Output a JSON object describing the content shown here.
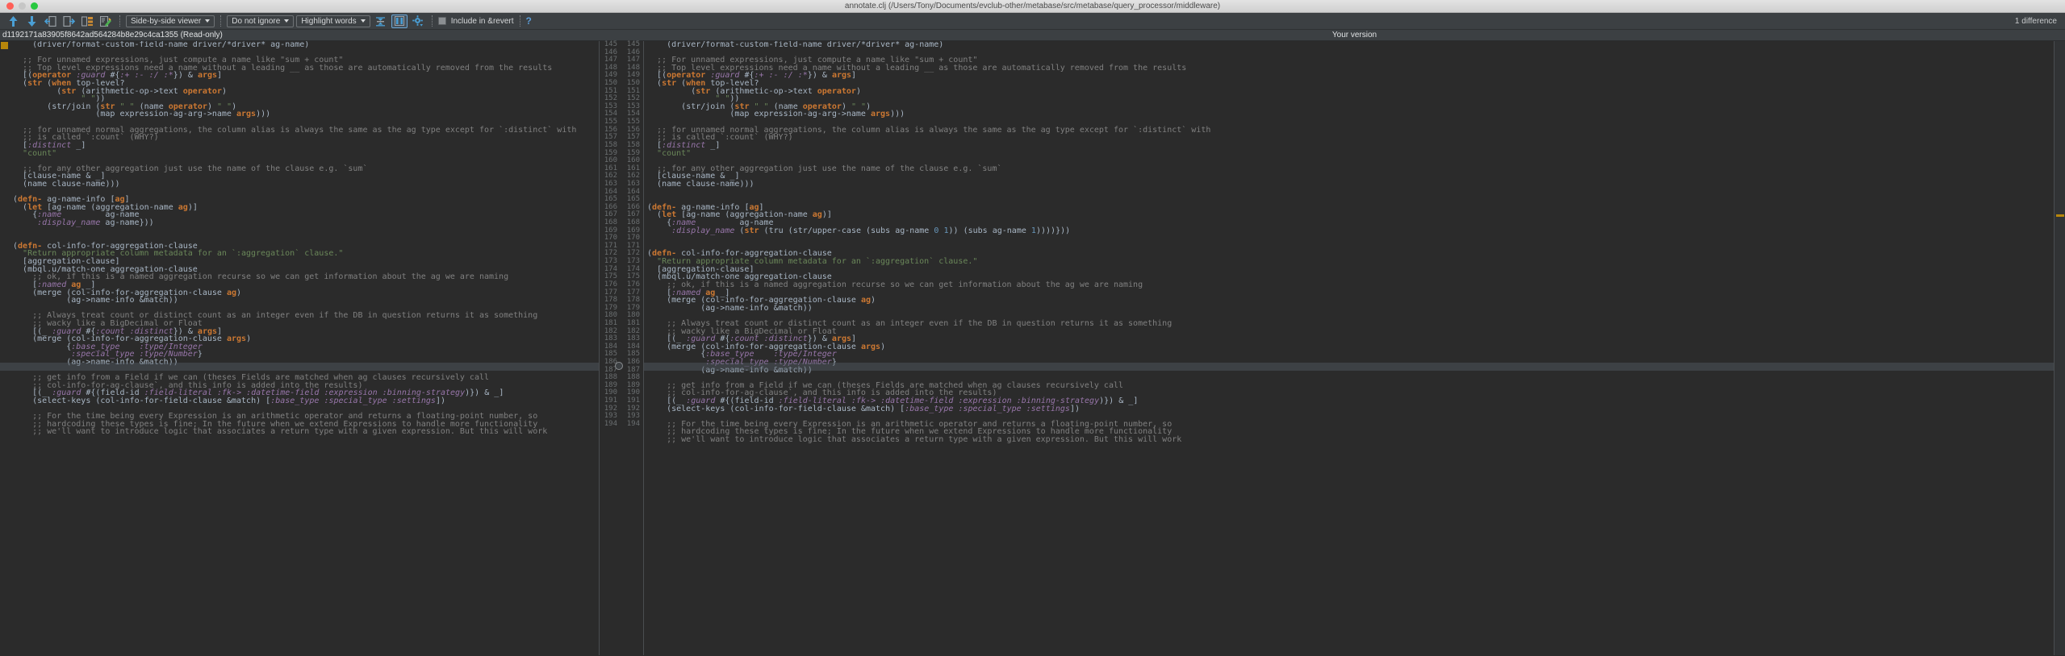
{
  "window": {
    "title": "annotate.clj (/Users/Tony/Documents/evclub-other/metabase/src/metabase/query_processor/middleware)"
  },
  "toolbar": {
    "icons": [
      {
        "name": "previous-difference-icon",
        "glyph": "up-arrow"
      },
      {
        "name": "next-difference-icon",
        "glyph": "down-arrow"
      },
      {
        "name": "accept-left-icon",
        "glyph": "arrow-to-left-doc"
      },
      {
        "name": "accept-right-icon",
        "glyph": "arrow-to-right-doc"
      },
      {
        "name": "compare-files-icon",
        "glyph": "files-compare"
      },
      {
        "name": "edit-file-icon",
        "glyph": "pencil-doc"
      }
    ],
    "viewer_mode": "Side-by-side viewer",
    "ignore_mode": "Do not ignore",
    "highlight_mode": "Highlight words",
    "collapse_unchanged_icon": "collapse-unchanged-icon",
    "synchronize_panes_icon": "synchronize-panes-icon",
    "settings_icon": "gear-icon",
    "include_revert_label": "Include in &revert",
    "include_revert_checked": false,
    "help_label": "?",
    "difference_count": "1 difference"
  },
  "panels": {
    "left_label": "d1192171a83905f8642ad564284b8e29c4ca1355 (Read-only)",
    "right_label": "Your version"
  },
  "line_numbers": {
    "start": 145,
    "count": 50
  },
  "code": {
    "left_lines": [
      "    (driver/format-custom-field-name driver/*driver* ag-name)",
      "",
      "  ;; For unnamed expressions, just compute a name like \"sum + count\"",
      "  ;; Top level expressions need a name without a leading __ as those are automatically removed from the results",
      "  [(operator :guard #{:+ :- :/ :*}) & args]",
      "  (str (when top-level?",
      "         (str (arithmetic-op->text operator)",
      "              \" \"))",
      "       (str/join (str \" \" (name operator) \" \")",
      "                 (map expression-ag-arg->name args)))",
      "",
      "  ;; for unnamed normal aggregations, the column alias is always the same as the ag type except for `:distinct` with",
      "  ;; is called `:count` (WHY?)",
      "  [:distinct _]",
      "  \"count\"",
      "",
      "  ;; for any other aggregation just use the name of the clause e.g. `sum`",
      "  [clause-name & _]",
      "  (name clause-name)))",
      "",
      "(defn- ag-name-info [ag]",
      "  (let [ag-name (aggregation-name ag)]",
      "    {:name         ag-name",
      "     :display_name ag-name}))",
      "",
      "",
      "(defn- col-info-for-aggregation-clause",
      "  \"Return appropriate column metadata for an `:aggregation` clause.\"",
      "  [aggregation-clause]",
      "  (mbql.u/match-one aggregation-clause",
      "    ;; ok, if this is a named aggregation recurse so we can get information about the ag we are naming",
      "    [:named ag _]",
      "    (merge (col-info-for-aggregation-clause ag)",
      "           (ag->name-info &match))",
      "",
      "    ;; Always treat count or distinct count as an integer even if the DB in question returns it as something",
      "    ;; wacky like a BigDecimal or Float",
      "    [(_ :guard #{:count :distinct}) & args]",
      "    (merge (col-info-for-aggregation-clause args)",
      "           {:base_type    :type/Integer",
      "            :special_type :type/Number}",
      "           (ag->name-info &match))",
      "",
      "    ;; get info from a Field if we can (theses Fields are matched when ag clauses recursively call",
      "    ;; col-info-for-ag-clause`, and this info is added into the results)",
      "    [(_ :guard #{(field-id :field-literal :fk-> :datetime-field :expression :binning-strategy)}) & _]",
      "    (select-keys (col-info-for-field-clause &match) [:base_type :special_type :settings])",
      "",
      "    ;; For the time being every Expression is an arithmetic operator and returns a floating-point number, so",
      "    ;; hardcoding these types is fine; In the future when we extend Expressions to handle more functionality",
      "    ;; we'll want to introduce logic that associates a return type with a given expression. But this will work"
    ],
    "right_lines": [
      "    (driver/format-custom-field-name driver/*driver* ag-name)",
      "",
      "  ;; For unnamed expressions, just compute a name like \"sum + count\"",
      "  ;; Top level expressions need a name without a leading __ as those are automatically removed from the results",
      "  [(operator :guard #{:+ :- :/ :*}) & args]",
      "  (str (when top-level?",
      "         (str (arithmetic-op->text operator)",
      "              \" \"))",
      "       (str/join (str \" \" (name operator) \" \")",
      "                 (map expression-ag-arg->name args)))",
      "",
      "  ;; for unnamed normal aggregations, the column alias is always the same as the ag type except for `:distinct` with",
      "  ;; is called `:count` (WHY?)",
      "  [:distinct _]",
      "  \"count\"",
      "",
      "  ;; for any other aggregation just use the name of the clause e.g. `sum`",
      "  [clause-name & _]",
      "  (name clause-name)))",
      "",
      "",
      "(defn- ag-name-info [ag]",
      "  (let [ag-name (aggregation-name ag)]",
      "    {:name         ag-name",
      "     :display_name (str (tru (str/upper-case (subs ag-name 0 1)) (subs ag-name 1))))}))",
      "",
      "",
      "(defn- col-info-for-aggregation-clause",
      "  \"Return appropriate column metadata for an `:aggregation` clause.\"",
      "  [aggregation-clause]",
      "  (mbql.u/match-one aggregation-clause",
      "    ;; ok, if this is a named aggregation recurse so we can get information about the ag we are naming",
      "    [:named ag _]",
      "    (merge (col-info-for-aggregation-clause ag)",
      "           (ag->name-info &match))",
      "",
      "    ;; Always treat count or distinct count as an integer even if the DB in question returns it as something",
      "    ;; wacky like a BigDecimal or Float",
      "    [(_ :guard #{:count :distinct}) & args]",
      "    (merge (col-info-for-aggregation-clause args)",
      "           {:base_type    :type/Integer",
      "            :special_type :type/Number}",
      "           (ag->name-info &match))",
      "",
      "    ;; get info from a Field if we can (theses Fields are matched when ag clauses recursively call",
      "    ;; col-info-for-ag-clause`, and this info is added into the results)",
      "    [(_ :guard #{(field-id :field-literal :fk-> :datetime-field :expression :binning-strategy)}) & _]",
      "    (select-keys (col-info-for-field-clause &match) [:base_type :special_type :settings])",
      "",
      "    ;; For the time being every Expression is an arithmetic operator and returns a floating-point number, so",
      "    ;; hardcoding these types is fine; In the future when we extend Expressions to handle more functionality",
      "    ;; we'll want to introduce logic that associates a return type with a given expression. But this will work"
    ]
  },
  "colors": {
    "accent": "#5b9bd5",
    "marker": "#b8860b",
    "background": "#2b2b2b",
    "toolbar": "#3c4043",
    "comment": "#808080",
    "keyword": "#cc7832",
    "string": "#6a8759",
    "symbol": "#9876aa"
  }
}
